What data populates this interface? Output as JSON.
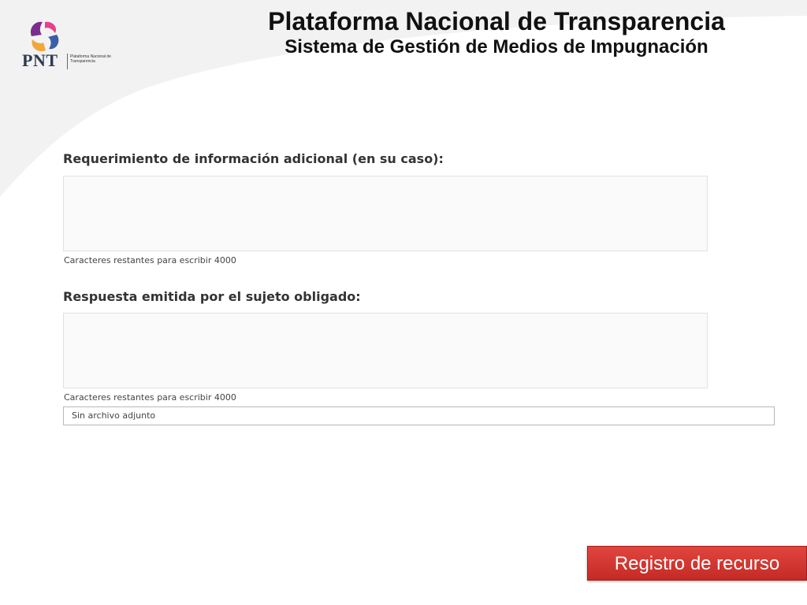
{
  "logo": {
    "acronym": "PNT",
    "subtitle": "Plataforma Nacional de Transparencia",
    "colors": [
      "#e8408e",
      "#7b2c8f",
      "#f2a63b",
      "#3a5fa8"
    ]
  },
  "header": {
    "title": "Plataforma Nacional de Transparencia",
    "subtitle": "Sistema de Gestión de Medios de Impugnación"
  },
  "form": {
    "additional_info": {
      "label": "Requerimiento de información adicional (en su caso):",
      "value": "",
      "counter": "Caracteres restantes para escribir 4000"
    },
    "response": {
      "label": "Respuesta emitida por el sujeto obligado:",
      "value": "",
      "counter": "Caracteres restantes para escribir 4000"
    },
    "attachment": {
      "text": "Sin archivo adjunto"
    }
  },
  "actions": {
    "register_label": "Registro de recurso",
    "register_color": "#d33a33"
  }
}
